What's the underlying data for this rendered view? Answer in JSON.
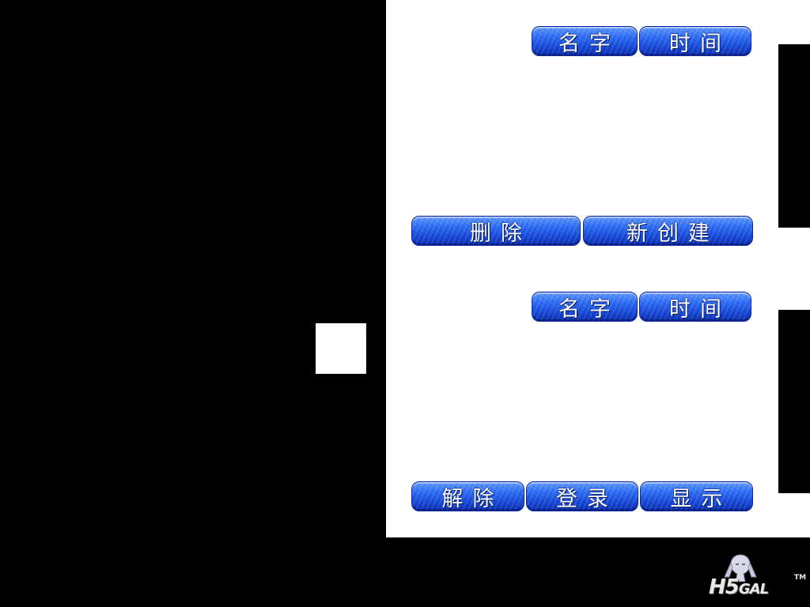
{
  "top_section": {
    "sort_name_label": "名字",
    "sort_time_label": "时间",
    "delete_label": "删除",
    "create_new_label": "新创建"
  },
  "bottom_section": {
    "sort_name_label": "名字",
    "sort_time_label": "时间",
    "remove_label": "解除",
    "register_label": "登录",
    "show_label": "显示"
  },
  "logo": {
    "brand_text_large": "H5",
    "brand_text_small": "GAL",
    "trademark": "TM"
  },
  "colors": {
    "background": "#000000",
    "panel": "#ffffff",
    "button_blue": "#2d6cf5"
  }
}
